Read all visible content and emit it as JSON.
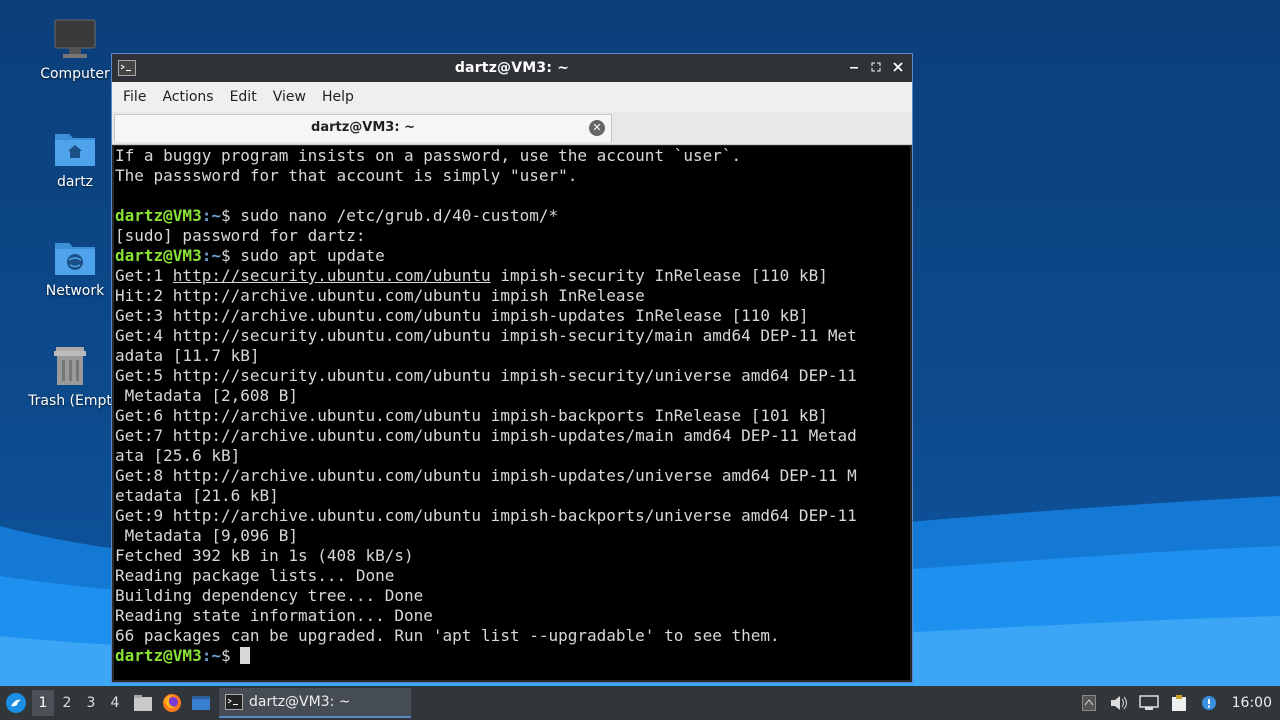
{
  "desktop": {
    "icons": [
      {
        "label": "Computer"
      },
      {
        "label": "dartz"
      },
      {
        "label": "Network"
      },
      {
        "label": "Trash (Empt"
      }
    ]
  },
  "window": {
    "title": "dartz@VM3: ~",
    "menu": [
      "File",
      "Actions",
      "Edit",
      "View",
      "Help"
    ],
    "tab_label": "dartz@VM3: ~"
  },
  "terminal": {
    "prompt_user": "dartz@VM3",
    "prompt_path": "~",
    "lines": [
      {
        "type": "text",
        "text": "If a buggy program insists on a password, use the account `user`."
      },
      {
        "type": "text",
        "text": "The passsword for that account is simply \"user\"."
      },
      {
        "type": "text",
        "text": ""
      },
      {
        "type": "prompt",
        "cmd": "sudo nano /etc/grub.d/40-custom/*"
      },
      {
        "type": "text",
        "text": "[sudo] password for dartz:"
      },
      {
        "type": "prompt",
        "cmd": "sudo apt update"
      },
      {
        "type": "link",
        "pre": "Get:1 ",
        "link": "http://security.ubuntu.com/ubuntu",
        "post": " impish-security InRelease [110 kB]"
      },
      {
        "type": "text",
        "text": "Hit:2 http://archive.ubuntu.com/ubuntu impish InRelease"
      },
      {
        "type": "text",
        "text": "Get:3 http://archive.ubuntu.com/ubuntu impish-updates InRelease [110 kB]"
      },
      {
        "type": "text",
        "text": "Get:4 http://security.ubuntu.com/ubuntu impish-security/main amd64 DEP-11 Met"
      },
      {
        "type": "text",
        "text": "adata [11.7 kB]"
      },
      {
        "type": "text",
        "text": "Get:5 http://security.ubuntu.com/ubuntu impish-security/universe amd64 DEP-11"
      },
      {
        "type": "text",
        "text": " Metadata [2,608 B]"
      },
      {
        "type": "text",
        "text": "Get:6 http://archive.ubuntu.com/ubuntu impish-backports InRelease [101 kB]"
      },
      {
        "type": "text",
        "text": "Get:7 http://archive.ubuntu.com/ubuntu impish-updates/main amd64 DEP-11 Metad"
      },
      {
        "type": "text",
        "text": "ata [25.6 kB]"
      },
      {
        "type": "text",
        "text": "Get:8 http://archive.ubuntu.com/ubuntu impish-updates/universe amd64 DEP-11 M"
      },
      {
        "type": "text",
        "text": "etadata [21.6 kB]"
      },
      {
        "type": "text",
        "text": "Get:9 http://archive.ubuntu.com/ubuntu impish-backports/universe amd64 DEP-11"
      },
      {
        "type": "text",
        "text": " Metadata [9,096 B]"
      },
      {
        "type": "text",
        "text": "Fetched 392 kB in 1s (408 kB/s)"
      },
      {
        "type": "text",
        "text": "Reading package lists... Done"
      },
      {
        "type": "text",
        "text": "Building dependency tree... Done"
      },
      {
        "type": "text",
        "text": "Reading state information... Done"
      },
      {
        "type": "text",
        "text": "66 packages can be upgraded. Run 'apt list --upgradable' to see them."
      },
      {
        "type": "prompt",
        "cmd": "",
        "cursor": true
      }
    ]
  },
  "taskbar": {
    "workspaces": [
      "1",
      "2",
      "3",
      "4"
    ],
    "active_workspace": "1",
    "task_label": "dartz@VM3: ~",
    "clock": "16:00"
  }
}
